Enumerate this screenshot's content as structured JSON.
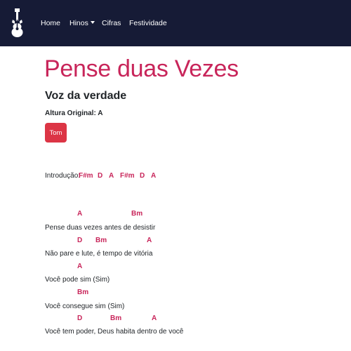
{
  "nav": {
    "items": [
      {
        "label": "Home"
      },
      {
        "label": "Hinos"
      },
      {
        "label": "Cifras"
      },
      {
        "label": "Festividade"
      }
    ]
  },
  "song": {
    "title": "Pense duas Vezes",
    "artist": "Voz da verdade",
    "original_key": "Altura Original: A",
    "tom_button": "Tom"
  },
  "intro": {
    "label": "Introdução:",
    "chords": [
      "F#m",
      "D",
      "A",
      "F#m",
      "D",
      "A"
    ]
  },
  "lines": [
    {
      "chords": [
        "A",
        "Bm"
      ],
      "lyric": "Pense duas vezes antes de desistir"
    },
    {
      "chords": [
        "D",
        "Bm",
        "A"
      ],
      "lyric": "Não pare e lute, é tempo de vitória"
    },
    {
      "chords": [
        "A"
      ],
      "lyric": "Você pode sim (Sim)"
    },
    {
      "chords": [
        "Bm"
      ],
      "lyric": "Você consegue sim (Sim)"
    },
    {
      "chords": [
        "D",
        "Bm",
        "A"
      ],
      "lyric": "Você tem poder, Deus habita dentro de você"
    }
  ],
  "colors": {
    "navbar": "#161b36",
    "accent": "#c8255a",
    "button": "#dc3545"
  }
}
